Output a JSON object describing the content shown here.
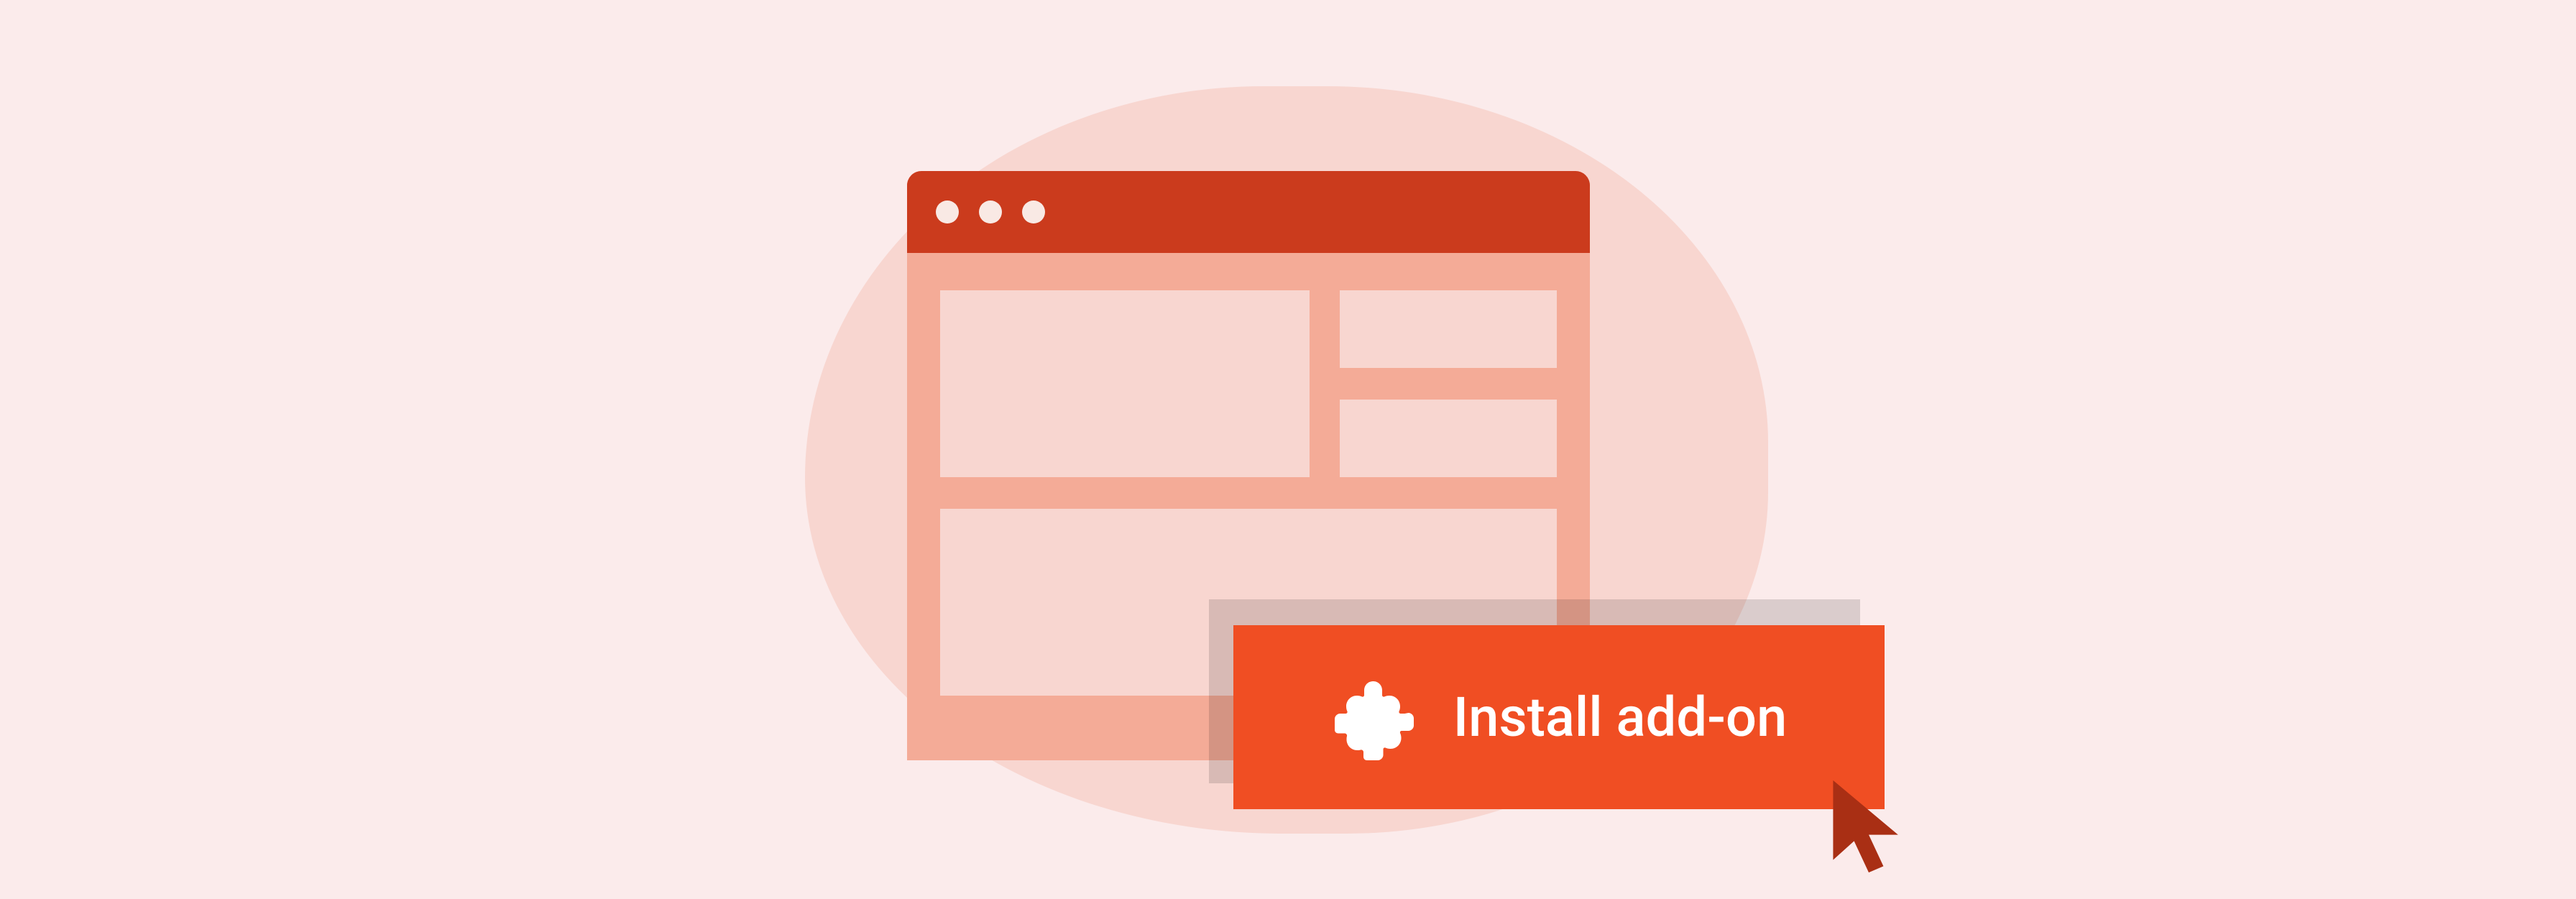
{
  "button": {
    "label": "Install add-on"
  },
  "colors": {
    "page_bg": "#fbebeb",
    "blob": "#f8d6d0",
    "browser_body": "#f4ab97",
    "browser_titlebar": "#cb3b1d",
    "browser_dot": "#f9e9e4",
    "panel": "#f8d6d0",
    "button_bg": "#f04e23",
    "button_text": "#ffffff",
    "cursor": "#a92f14"
  },
  "icons": {
    "puzzle": "puzzle-piece-icon",
    "cursor": "cursor-icon"
  }
}
